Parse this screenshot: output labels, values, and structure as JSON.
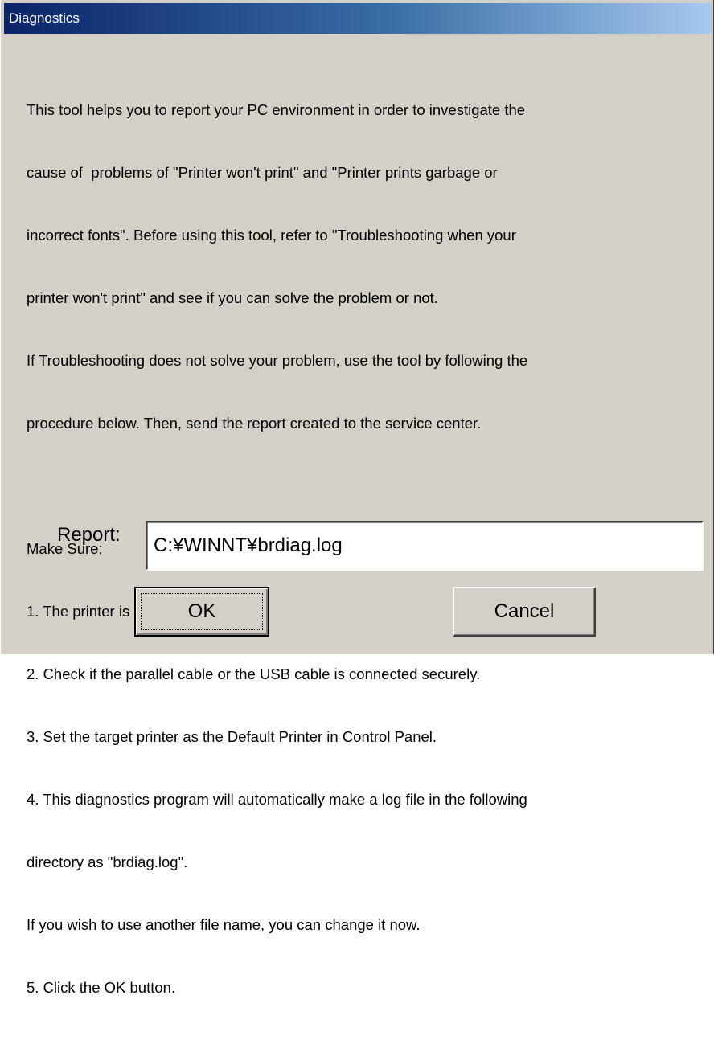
{
  "window": {
    "title": "Diagnostics"
  },
  "instructions": {
    "lines": [
      "This tool helps you to report your PC environment in order to investigate the",
      "cause of  problems of \"Printer won't print\" and \"Printer prints garbage or",
      "incorrect fonts\". Before using this tool, refer to \"Troubleshooting when your",
      "printer won't print\" and see if you can solve the problem or not.",
      "If Troubleshooting does not solve your problem, use the tool by following the",
      "procedure below. Then, send the report created to the service center.",
      "",
      "Make Sure:",
      "1. The printer is powered on.",
      "2. Check if the parallel cable or the USB cable is connected securely.",
      "3. Set the target printer as the Default Printer in Control Panel.",
      "4. This diagnostics program will automatically make a log file in the following",
      "directory as \"brdiag.log\".",
      "If you wish to use another file name, you can change it now.",
      "5. Click the OK button."
    ]
  },
  "report": {
    "label": "Report:",
    "value": "C:¥WINNT¥brdiag.log"
  },
  "buttons": {
    "ok_label": "OK",
    "cancel_label": "Cancel"
  }
}
